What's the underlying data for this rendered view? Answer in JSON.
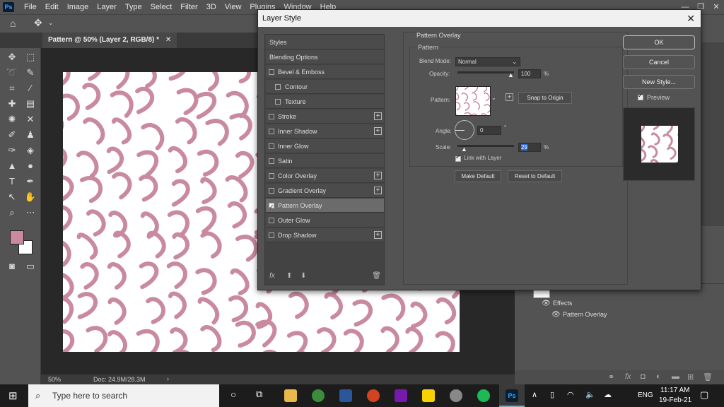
{
  "menu": [
    "File",
    "Edit",
    "Image",
    "Layer",
    "Type",
    "Select",
    "Filter",
    "3D",
    "View",
    "Plugins",
    "Window",
    "Help"
  ],
  "app_logo": "Ps",
  "doc_tab": "Pattern @ 50% (Layer 2, RGB/8) *",
  "status": {
    "zoom": "50%",
    "doc": "Doc: 24.9M/28.3M"
  },
  "dialog": {
    "title": "Layer Style",
    "styles": [
      {
        "label": "Styles",
        "check": null,
        "plus": false
      },
      {
        "label": "Blending Options",
        "check": null,
        "plus": false
      },
      {
        "label": "Bevel & Emboss",
        "check": false,
        "plus": false
      },
      {
        "label": "Contour",
        "check": false,
        "plus": false,
        "indent": true
      },
      {
        "label": "Texture",
        "check": false,
        "plus": false,
        "indent": true
      },
      {
        "label": "Stroke",
        "check": false,
        "plus": true
      },
      {
        "label": "Inner Shadow",
        "check": false,
        "plus": true
      },
      {
        "label": "Inner Glow",
        "check": false,
        "plus": false
      },
      {
        "label": "Satin",
        "check": false,
        "plus": false
      },
      {
        "label": "Color Overlay",
        "check": false,
        "plus": true
      },
      {
        "label": "Gradient Overlay",
        "check": false,
        "plus": true
      },
      {
        "label": "Pattern Overlay",
        "check": true,
        "plus": false,
        "selected": true
      },
      {
        "label": "Outer Glow",
        "check": false,
        "plus": false
      },
      {
        "label": "Drop Shadow",
        "check": false,
        "plus": true
      }
    ],
    "fx_label": "fx",
    "section_title": "Pattern Overlay",
    "subsection": "Pattern",
    "blend_mode_label": "Blend Mode:",
    "blend_mode_value": "Normal",
    "opacity_label": "Opacity:",
    "opacity_value": "100",
    "opacity_unit": "%",
    "pattern_label": "Pattern:",
    "snap_button": "Snap to Origin",
    "angle_label": "Angle:",
    "angle_value": "0",
    "angle_unit": "°",
    "scale_label": "Scale:",
    "scale_value": "29",
    "scale_unit": "%",
    "link_label": "Link with Layer",
    "make_default": "Make Default",
    "reset_default": "Reset to Default",
    "ok": "OK",
    "cancel": "Cancel",
    "new_style": "New Style...",
    "preview_label": "Preview"
  },
  "layers": {
    "effects": "Effects",
    "pattern_overlay": "Pattern Overlay"
  },
  "taskbar": {
    "search_placeholder": "Type here to search",
    "lang": "ENG",
    "time": "11:17 AM",
    "date": "19-Feb-21"
  },
  "colors": {
    "pattern": "#c98a9e",
    "fg_swatch": "#c98a9e",
    "bg_swatch": "#ffffff"
  }
}
